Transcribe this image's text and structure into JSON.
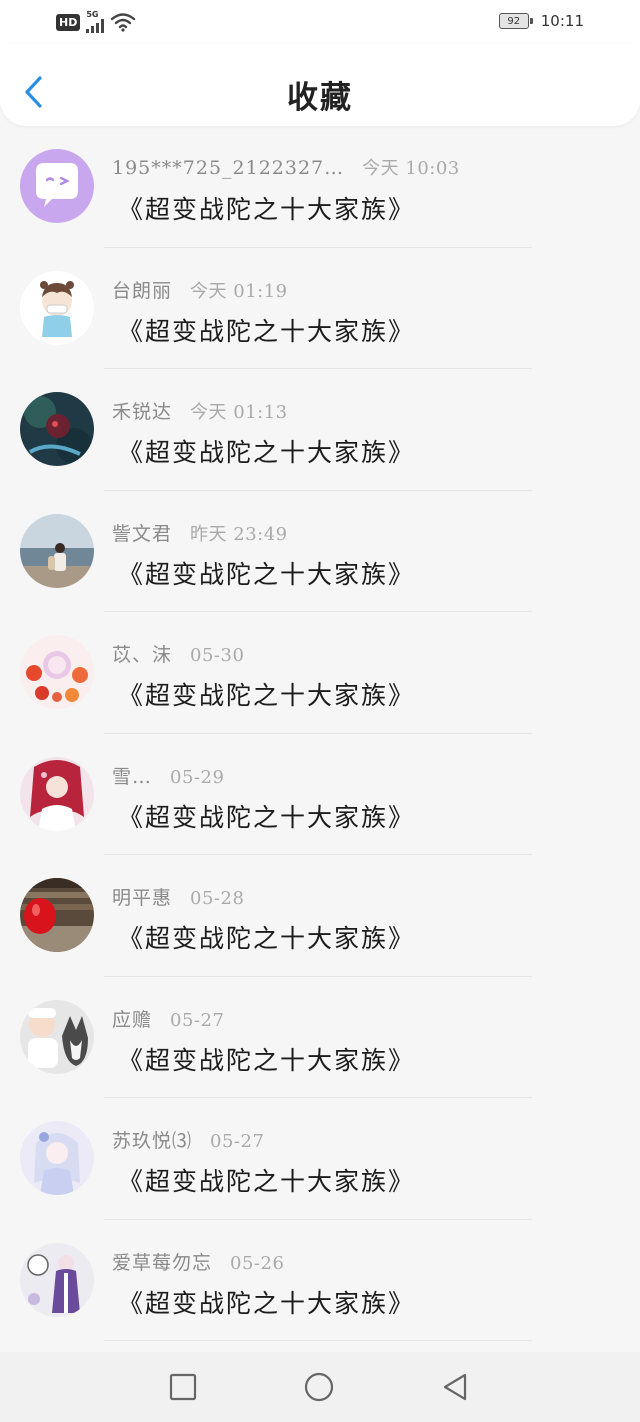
{
  "status_bar": {
    "hd_label": "HD",
    "network_label": "5G",
    "battery_level": "92",
    "time": "10:11"
  },
  "header": {
    "title": "收藏",
    "back_icon": "chevron-left-icon"
  },
  "favorites": [
    {
      "user": "195***725_2122327…",
      "time": "今天 10:03",
      "title": "《超变战陀之十大家族》"
    },
    {
      "user": "台朗丽",
      "time": "今天 01:19",
      "title": "《超变战陀之十大家族》"
    },
    {
      "user": "禾锐达",
      "time": "今天 01:13",
      "title": "《超变战陀之十大家族》"
    },
    {
      "user": "訾文君",
      "time": "昨天 23:49",
      "title": "《超变战陀之十大家族》"
    },
    {
      "user": "苡、沫",
      "time": "05-30",
      "title": "《超变战陀之十大家族》"
    },
    {
      "user": "雪…",
      "time": "05-29",
      "title": "《超变战陀之十大家族》"
    },
    {
      "user": "明平惠",
      "time": "05-28",
      "title": "《超变战陀之十大家族》"
    },
    {
      "user": "应赡",
      "time": "05-27",
      "title": "《超变战陀之十大家族》"
    },
    {
      "user": "苏玖悦⑶",
      "time": "05-27",
      "title": "《超变战陀之十大家族》"
    },
    {
      "user": "爱草莓勿忘",
      "time": "05-26",
      "title": "《超变战陀之十大家族》"
    }
  ],
  "nav_bar": {
    "icons": [
      "recents-square-icon",
      "home-circle-icon",
      "back-triangle-icon"
    ]
  },
  "colors": {
    "accent": "#2a8fe6",
    "name_text": "#8a8a8a",
    "title_text": "#1c1c1c"
  }
}
